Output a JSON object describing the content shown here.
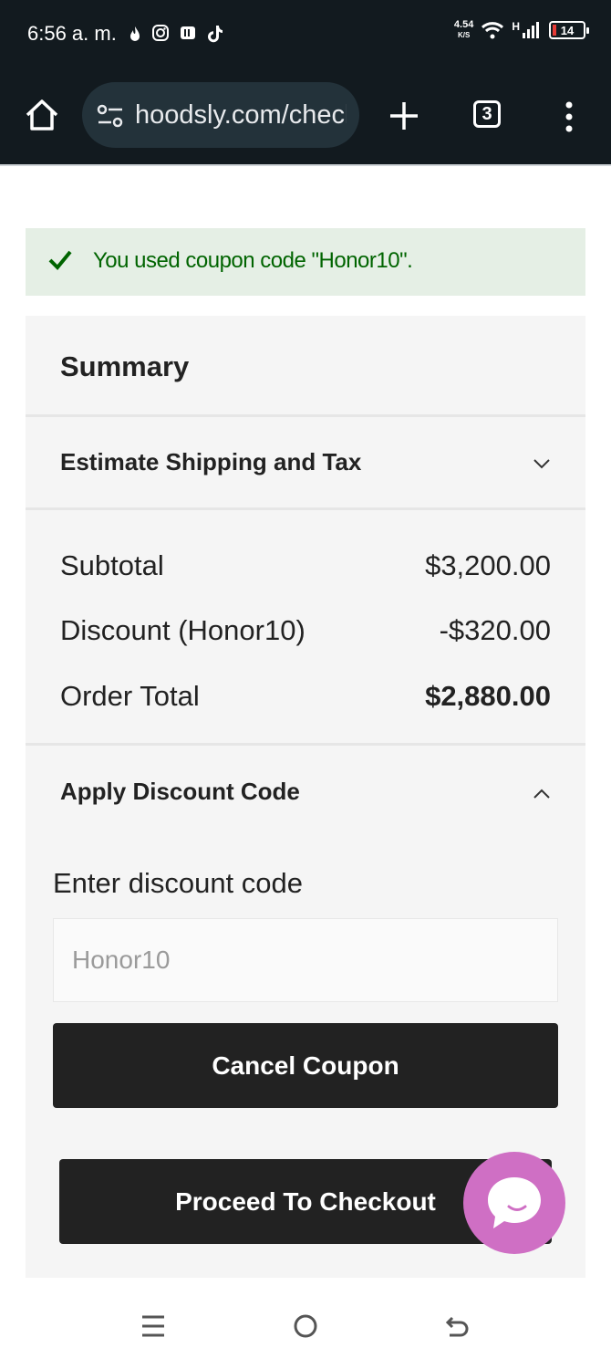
{
  "status_bar": {
    "time": "6:56 a. m.",
    "net_speed_value": "4.54",
    "net_speed_unit": "K/S",
    "network_type": "H",
    "battery_level": "14",
    "icons": [
      "flame-icon",
      "instagram-icon",
      "reader-icon",
      "tiktok-icon",
      "wifi-icon",
      "signal-icon",
      "battery-icon"
    ]
  },
  "browser": {
    "url": "hoodsly.com/checkout",
    "tab_count": "3",
    "icons": [
      "home-icon",
      "site-settings-icon",
      "plus-icon",
      "tabs-icon",
      "more-vert-icon"
    ]
  },
  "notice": {
    "message": "You used coupon code \"Honor10\".",
    "color": "#006400",
    "background": "#e5efe5"
  },
  "summary": {
    "title": "Summary",
    "shipping_section": {
      "label": "Estimate Shipping and Tax",
      "expanded": false
    },
    "rows": [
      {
        "label": "Subtotal",
        "value": "$3,200.00"
      },
      {
        "label": "Discount (Honor10)",
        "value": "-$320.00"
      },
      {
        "label": "Order Total",
        "value": "$2,880.00"
      }
    ],
    "discount_section": {
      "label": "Apply Discount Code",
      "expanded": true,
      "field_label": "Enter discount code",
      "field_value": "Honor10",
      "cancel_label": "Cancel Coupon"
    },
    "checkout_label": "Proceed To Checkout"
  },
  "chat": {
    "color": "#cf6fc4",
    "icon": "chat-icon"
  },
  "nav_bar": {
    "icons": [
      "recents-icon",
      "home-circle-icon",
      "back-icon"
    ]
  }
}
